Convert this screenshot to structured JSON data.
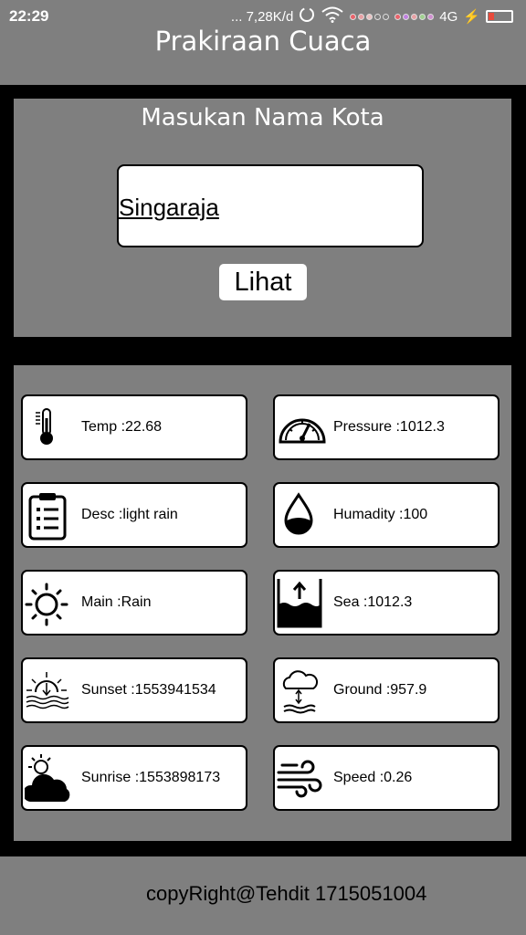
{
  "status_bar": {
    "time": "22:29",
    "network_speed": "... 7,28K/d",
    "network_type": "4G"
  },
  "app": {
    "title": "Prakiraan Cuaca"
  },
  "search": {
    "label": "Masukan Nama Kota",
    "city_value": "Singaraja",
    "button_label": "Lihat"
  },
  "weather": {
    "temp": "Temp :22.68",
    "pressure": "Pressure :1012.3",
    "desc": "Desc :light rain",
    "humidity": "Humadity :100",
    "main": "Main :Rain",
    "sea": "Sea :1012.3",
    "sunset": "Sunset :1553941534",
    "ground": "Ground :957.9",
    "sunrise": "Sunrise :1553898173",
    "speed": "Speed :0.26"
  },
  "icons": {
    "temp": "thermometer-icon",
    "pressure": "gauge-icon",
    "desc": "clipboard-icon",
    "humidity": "water-drop-icon",
    "main": "sun-icon",
    "sea": "sea-level-icon",
    "sunset": "sunset-icon",
    "ground": "ground-level-icon",
    "sunrise": "sunrise-icon",
    "speed": "wind-icon"
  },
  "footer": {
    "text": "copyRight@Tehdit 1715051004"
  }
}
